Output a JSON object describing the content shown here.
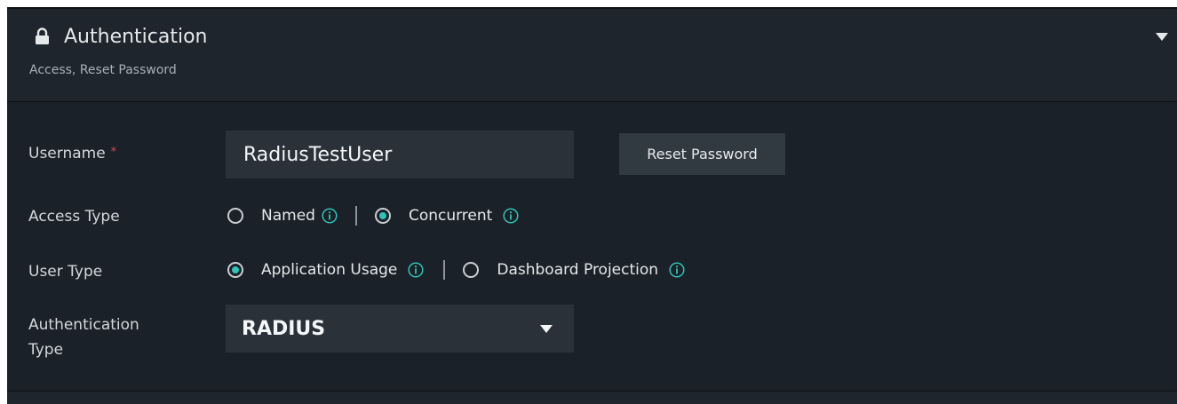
{
  "section": {
    "title": "Authentication",
    "subtitle": "Access, Reset Password",
    "icon": "lock-icon",
    "collapse_icon": "caret-down-icon"
  },
  "form": {
    "username": {
      "label": "Username",
      "required_marker": "*",
      "value": "RadiusTestUser"
    },
    "reset_password_label": "Reset Password",
    "access_type": {
      "label": "Access Type",
      "options": [
        {
          "label": "Named",
          "selected": false
        },
        {
          "label": "Concurrent",
          "selected": true
        }
      ]
    },
    "user_type": {
      "label": "User Type",
      "options": [
        {
          "label": "Application Usage",
          "selected": true
        },
        {
          "label": "Dashboard Projection",
          "selected": false
        }
      ]
    },
    "authentication_type": {
      "label_line1": "Authentication",
      "label_line2": "Type",
      "value": "RADIUS"
    }
  },
  "colors": {
    "panel_bg": "#1b2128",
    "accent": "#2ec4b6",
    "required": "#e0405a"
  }
}
